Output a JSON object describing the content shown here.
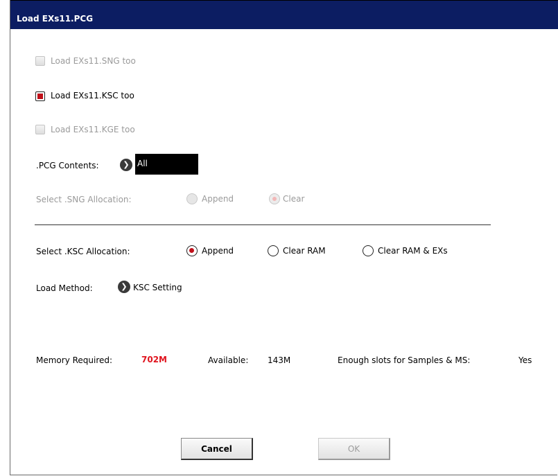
{
  "dialog": {
    "title": "Load EXs11.PCG"
  },
  "options": {
    "sng": {
      "label": "Load EXs11.SNG too",
      "checked": false,
      "enabled": false
    },
    "ksc": {
      "label": "Load EXs11.KSC too",
      "checked": true,
      "enabled": true
    },
    "kge": {
      "label": "Load EXs11.KGE too",
      "checked": false,
      "enabled": false
    }
  },
  "pcg_contents": {
    "label": ".PCG Contents:",
    "value": "All"
  },
  "sng_allocation": {
    "label": "Select .SNG Allocation:",
    "options": [
      "Append",
      "Clear"
    ],
    "selected": "Clear",
    "enabled": false
  },
  "ksc_allocation": {
    "label": "Select .KSC Allocation:",
    "options": [
      "Append",
      "Clear RAM",
      "Clear RAM & EXs"
    ],
    "selected": "Append"
  },
  "load_method": {
    "label": "Load Method:",
    "value": "KSC Setting"
  },
  "memory": {
    "required_label": "Memory Required:",
    "required_value": "702M",
    "available_label": "Available:",
    "available_value": "143M",
    "slots_label": "Enough slots for Samples & MS:",
    "slots_value": "Yes"
  },
  "buttons": {
    "cancel": "Cancel",
    "ok": "OK"
  },
  "colors": {
    "title_bar": "#0c1d62",
    "accent_red": "#c0101a",
    "memory_warning": "#e0141e"
  }
}
